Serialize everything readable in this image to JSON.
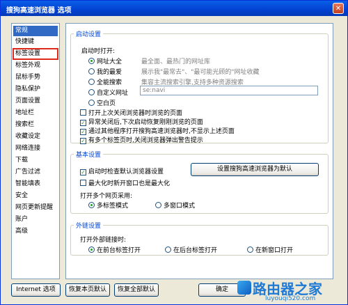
{
  "window": {
    "title": "搜狗高速浏览器 选项",
    "close_glyph": "✕"
  },
  "nav": {
    "items": [
      "常规",
      "快捷键",
      "标签设置",
      "标签外观",
      "鼠标手势",
      "隐私保护",
      "页面设置",
      "地址栏",
      "搜索栏",
      "收藏设定",
      "网络连接",
      "下载",
      "广告过滤",
      "智能填表",
      "安全",
      "网页更新提醒",
      "账户",
      "高级"
    ],
    "selected_index": 0,
    "highlighted_index": 2
  },
  "startup": {
    "legend": "启动设置",
    "open_label": "启动时打开:",
    "options": [
      {
        "label": "网址大全",
        "desc": "最全面、最热门的网址库"
      },
      {
        "label": "我的最爱",
        "desc": "展示我\"最常去\"、\"最可能光顾的\"网址收藏"
      },
      {
        "label": "全能搜索",
        "desc": "集容主流搜索引擎,支持多种资源搜索"
      },
      {
        "label": "自定义网址",
        "desc": ""
      },
      {
        "label": "空白页",
        "desc": ""
      }
    ],
    "selected_option": 0,
    "custom_url_placeholder": "se:navi",
    "checkboxes": [
      {
        "label": "打开上次关闭浏览器时浏览的页面",
        "checked": false
      },
      {
        "label": "异常关闭后,下次启动恢复刚刚浏览的页面",
        "checked": true
      },
      {
        "label": "通过其他程序打开搜狗高速浏览器时,不显示上述页面",
        "checked": true
      },
      {
        "label": "有多个标签页时,关闭浏览器弹出警告提示",
        "checked": true
      }
    ]
  },
  "basic": {
    "legend": "基本设置",
    "check_default": {
      "label": "启动时检查默认浏览器设置",
      "checked": true
    },
    "set_default_button": "设置搜狗高速浏览器为默认",
    "maximize": {
      "label": "最大化时新开窗口也是最大化",
      "checked": false
    },
    "multi_label": "打开多个网页采用:",
    "modes": [
      "多标签模式",
      "多窗口模式"
    ],
    "selected_mode": 0
  },
  "external": {
    "legend": "外链设置",
    "open_label": "打开外部链接时:",
    "options": [
      "在前台标签打开",
      "在后台标签打开",
      "在新窗口打开"
    ],
    "selected_option": 0
  },
  "footer": {
    "internet_options": "Internet 选项",
    "restore_page": "恢复本页默认",
    "restore_all": "恢复全部默认",
    "ok": "确定"
  },
  "watermark": {
    "brand": "路由器之家",
    "url": "luyouqi520.com"
  },
  "colors": {
    "accent": "#0046d5",
    "selection": "#316ac5",
    "highlight": "#e0281a",
    "check": "#21a121"
  }
}
